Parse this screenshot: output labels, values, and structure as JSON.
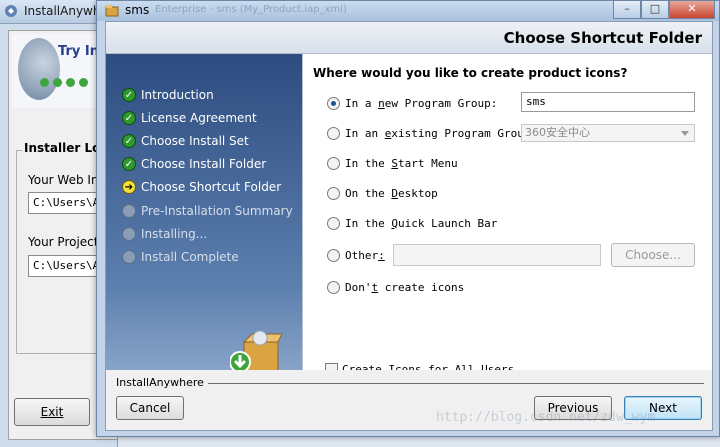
{
  "bg_window": {
    "title": "InstallAnywh",
    "try_label": "Try Ins",
    "group_title": "Installer Loca",
    "web_label": "Your Web In",
    "web_value": "C:\\Users\\Ad",
    "project_label": "Your Project",
    "project_value": "C:\\Users\\Ad",
    "exit_label": "Exit"
  },
  "window": {
    "title": "sms",
    "ghost_title": "Enterprise - sms (My_Product.iap_xml)",
    "min_label": "–",
    "max_label": "□",
    "close_label": "✕"
  },
  "header": {
    "title": "Choose Shortcut Folder"
  },
  "steps": [
    {
      "label": "Introduction",
      "state": "done"
    },
    {
      "label": "License Agreement",
      "state": "done"
    },
    {
      "label": "Choose Install Set",
      "state": "done"
    },
    {
      "label": "Choose Install Folder",
      "state": "done"
    },
    {
      "label": "Choose Shortcut Folder",
      "state": "current"
    },
    {
      "label": "Pre-Installation Summary",
      "state": "todo"
    },
    {
      "label": "Installing...",
      "state": "todo"
    },
    {
      "label": "Install Complete",
      "state": "todo"
    }
  ],
  "content": {
    "question": "Where would you like to create product icons?",
    "options": [
      {
        "label_pre": "In a ",
        "label_u": "n",
        "label_post": "ew Program Group:",
        "selected": true
      },
      {
        "label_pre": "In an ",
        "label_u": "e",
        "label_post": "xisting Program Group:",
        "selected": false
      },
      {
        "label_pre": "In the ",
        "label_u": "S",
        "label_post": "tart Menu",
        "selected": false
      },
      {
        "label_pre": "On the ",
        "label_u": "D",
        "label_post": "esktop",
        "selected": false
      },
      {
        "label_pre": "In the ",
        "label_u": "Q",
        "label_post": "uick Launch Bar",
        "selected": false
      },
      {
        "label_pre": "Other",
        "label_u": ":",
        "label_post": "",
        "selected": false
      },
      {
        "label_pre": "Don'",
        "label_u": "t",
        "label_post": " create icons",
        "selected": false
      }
    ],
    "new_group_value": "sms",
    "existing_group_value": "360安全中心",
    "other_value": "",
    "choose_label": "Choose...",
    "all_users_label_u": "r",
    "all_users_label_pre": "C",
    "all_users_label_post": "eate Icons for All Users"
  },
  "footer": {
    "brand": "InstallAnywhere",
    "cancel_label": "Cancel",
    "previous_label": "Previous",
    "next_label": "Next",
    "watermark": "http://blog.csdn.net/zdw_wym"
  },
  "colors": {
    "sidebar_top": "#2d4c80",
    "step_done": "#2e9a2e",
    "step_current": "#f2e23a",
    "default_button": "#3c7fb1"
  }
}
